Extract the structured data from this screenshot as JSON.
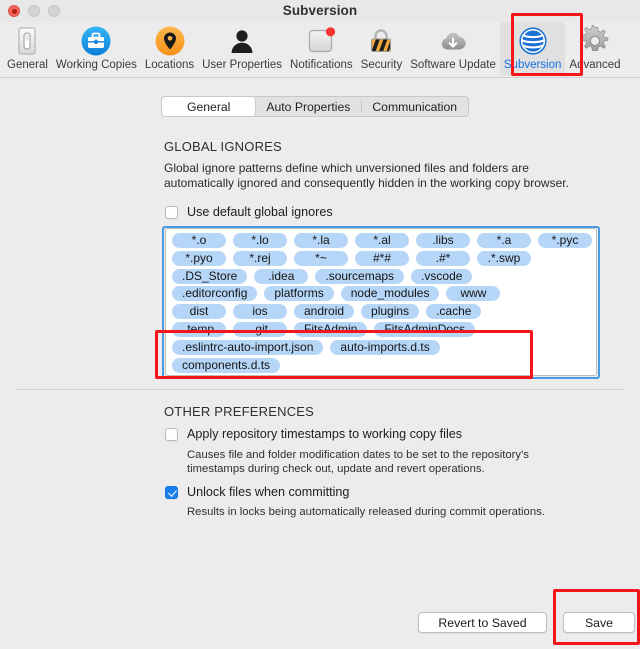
{
  "window": {
    "title": "Subversion",
    "traffic_lights": [
      "close-button",
      "minimize-button",
      "maximize-button"
    ]
  },
  "toolbar": {
    "items": [
      {
        "label": "General",
        "icon": "switch-icon",
        "selected": false
      },
      {
        "label": "Working Copies",
        "icon": "briefcase-icon",
        "selected": false
      },
      {
        "label": "Locations",
        "icon": "map-pin-icon",
        "selected": false
      },
      {
        "label": "User Properties",
        "icon": "person-icon",
        "selected": false
      },
      {
        "label": "Notifications",
        "icon": "notification-icon",
        "selected": false
      },
      {
        "label": "Security",
        "icon": "padlock-icon",
        "selected": false
      },
      {
        "label": "Software Update",
        "icon": "cloud-download-icon",
        "selected": false
      },
      {
        "label": "Subversion",
        "icon": "subversion-icon",
        "selected": true
      },
      {
        "label": "Advanced",
        "icon": "gear-icon",
        "selected": false
      }
    ]
  },
  "tabs": {
    "items": [
      {
        "label": "General",
        "active": true
      },
      {
        "label": "Auto Properties",
        "active": false
      },
      {
        "label": "Communication",
        "active": false
      }
    ]
  },
  "global_ignores": {
    "heading": "GLOBAL IGNORES",
    "description_line1": "Global ignore patterns define which unversioned files and folders are",
    "description_line2": "automatically ignored and consequently hidden in the working copy browser.",
    "use_default_checkbox": {
      "label": "Use default global ignores",
      "checked": false
    },
    "token_rows": [
      [
        "*.o",
        "*.lo",
        "*.la",
        "*.al",
        ".libs",
        "*.a",
        "*.pyc"
      ],
      [
        "*.pyo",
        "*.rej",
        "*~",
        "#*#",
        ".#*",
        ".*.swp"
      ],
      [
        ".DS_Store",
        ".idea",
        ".sourcemaps",
        ".vscode"
      ],
      [
        ".editorconfig",
        "platforms",
        "node_modules",
        "www"
      ],
      [
        "dist",
        "ios",
        "android",
        "plugins",
        ".cache"
      ],
      [
        ".temp",
        ".git",
        "FitsAdmin",
        "FitsAdminDocs"
      ],
      [
        ".eslintrc-auto-import.json",
        "auto-imports.d.ts"
      ],
      [
        "components.d.ts"
      ]
    ]
  },
  "other_preferences": {
    "heading": "OTHER PREFERENCES",
    "apply_timestamps": {
      "label": "Apply repository timestamps to working copy files",
      "checked": false,
      "description_line1": "Causes file and folder modification dates to be set to the repository's",
      "description_line2": "timestamps during check out, update and revert operations."
    },
    "unlock_files": {
      "label": "Unlock files when committing",
      "checked": true,
      "description_line1": "Results in locks being automatically released during commit operations."
    }
  },
  "footer": {
    "revert_label": "Revert to Saved",
    "save_label": "Save"
  },
  "colors": {
    "accent_blue": "#1472e6",
    "token_blue": "#b6d6f7",
    "annotation_red": "#f5161b",
    "highlight_blue": "#4a9ae8",
    "window_bg": "#ececec"
  }
}
